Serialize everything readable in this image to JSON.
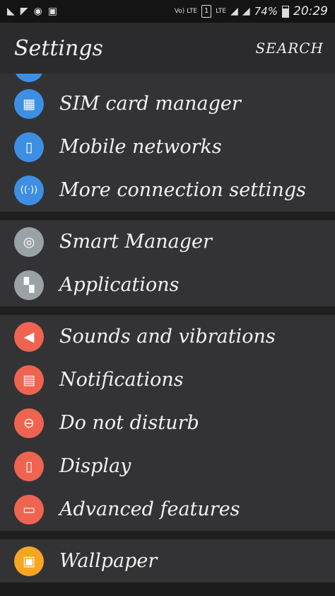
{
  "statusbar": {
    "net_tag_1": "Vo) LTE",
    "sim_number": "1",
    "net_tag_2": "LTE",
    "battery_percent": "74%",
    "time": "20:29"
  },
  "appbar": {
    "title": "Settings",
    "search_label": "SEARCH"
  },
  "colors": {
    "blue": "#3d8fe4",
    "grey": "#9aa2a6",
    "red": "#ef6450",
    "orange": "#f6a623"
  },
  "groups": [
    {
      "items": [
        {
          "label": "SIM card manager",
          "icon": "sim-card-icon",
          "glyph": "▦"
        },
        {
          "label": "Mobile networks",
          "icon": "mobile-network-icon",
          "glyph": "▯"
        },
        {
          "label": "More connection settings",
          "icon": "wireless-antenna-icon",
          "glyph": "((·))"
        }
      ]
    },
    {
      "items": [
        {
          "label": "Smart Manager",
          "icon": "power-circle-icon",
          "glyph": "◎"
        },
        {
          "label": "Applications",
          "icon": "apps-grid-icon",
          "glyph": "▚"
        }
      ]
    },
    {
      "items": [
        {
          "label": "Sounds and vibrations",
          "icon": "speaker-icon",
          "glyph": "◀"
        },
        {
          "label": "Notifications",
          "icon": "notification-list-icon",
          "glyph": "▤"
        },
        {
          "label": "Do not disturb",
          "icon": "do-not-disturb-icon",
          "glyph": "⊖"
        },
        {
          "label": "Display",
          "icon": "display-settings-icon",
          "glyph": "▯"
        },
        {
          "label": "Advanced features",
          "icon": "advanced-features-icon",
          "glyph": "▭"
        }
      ]
    },
    {
      "items": [
        {
          "label": "Wallpaper",
          "icon": "wallpaper-image-icon",
          "glyph": "▣"
        }
      ]
    }
  ]
}
